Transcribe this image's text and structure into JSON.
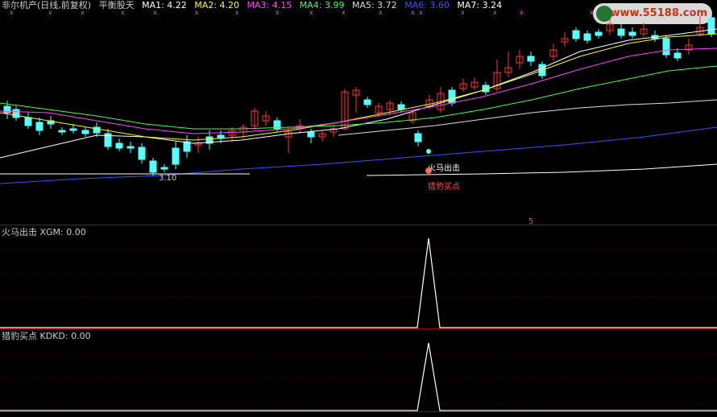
{
  "header": {
    "stock": "非尔机产(日线,前复权)",
    "indicator": "平衡股天",
    "ma": [
      {
        "label": "MA1: 4.22",
        "color": "#ffffff"
      },
      {
        "label": "MA2: 4.20",
        "color": "#ffff00"
      },
      {
        "label": "MA3: 4.15",
        "color": "#ff44ff"
      },
      {
        "label": "MA4: 3.99",
        "color": "#44ff44"
      },
      {
        "label": "MA5: 3.72",
        "color": "#dddddd"
      },
      {
        "label": "MA6: 3.60",
        "color": "#3355ff"
      },
      {
        "label": "MA7: 3.24",
        "color": "#ffffff"
      }
    ]
  },
  "watermark": {
    "text": "www.55188.com",
    "brand": "#d41"
  },
  "main_panel": {
    "low_label": "3.10",
    "signal_top": "火马出击",
    "signal_bottom": "猎豹买点",
    "marker_top": "5"
  },
  "sub1": {
    "title": "火马出击",
    "value": "XGM: 0.00"
  },
  "sub2": {
    "title": "猎豹买点",
    "value": "KDKD: 0.00"
  },
  "colors": {
    "up": "#ff3333",
    "down": "#54ffff",
    "grid": "#b00000"
  }
}
